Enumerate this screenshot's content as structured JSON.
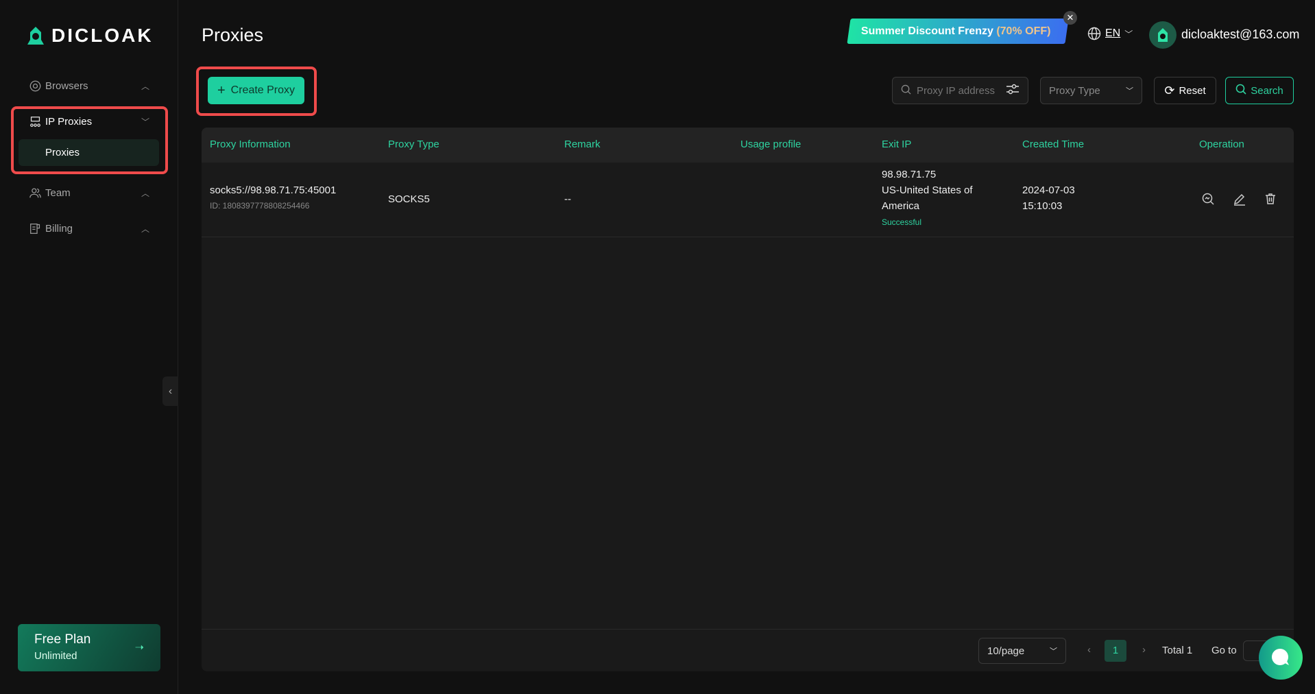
{
  "app": {
    "logo": "DICLOAK",
    "page_title": "Proxies"
  },
  "sidebar": {
    "items": [
      {
        "label": "Browsers"
      },
      {
        "label": "IP Proxies",
        "sub": "Proxies"
      },
      {
        "label": "Team"
      },
      {
        "label": "Billing"
      }
    ],
    "plan": {
      "title": "Free Plan",
      "subtitle": "Unlimited"
    }
  },
  "header": {
    "banner": "Summer Discount Frenzy",
    "banner_offer": "(70% OFF)",
    "language": "EN",
    "user_email": "dicloaktest@163.com"
  },
  "toolbar": {
    "create_label": "Create Proxy",
    "search_placeholder": "Proxy IP address",
    "type_placeholder": "Proxy Type",
    "reset_label": "Reset",
    "search_label": "Search"
  },
  "table": {
    "columns": [
      "Proxy Information",
      "Proxy Type",
      "Remark",
      "Usage profile",
      "Exit IP",
      "Created Time",
      "Operation"
    ],
    "rows": [
      {
        "proxy": "socks5://98.98.71.75:45001",
        "id": "ID: 1808397778808254466",
        "type": "SOCKS5",
        "remark": "--",
        "usage": "",
        "exit_ip": "98.98.71.75",
        "exit_loc_1": "US-United States of",
        "exit_loc_2": "America",
        "status": "Successful",
        "created_date": "2024-07-03",
        "created_time": "15:10:03"
      }
    ]
  },
  "pagination": {
    "page_size": "10/page",
    "current": "1",
    "total": "Total 1",
    "goto": "Go to"
  },
  "colors": {
    "accent": "#1ecf9f",
    "highlight": "#ef4b4b"
  }
}
